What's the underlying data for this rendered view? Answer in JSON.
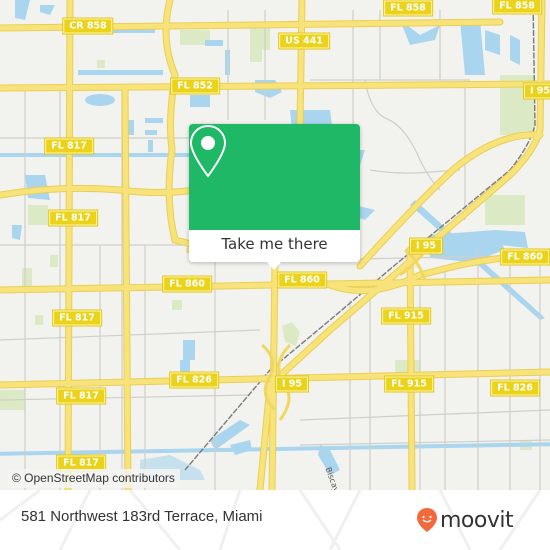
{
  "map": {
    "attribution": "© OpenStreetMap contributors",
    "colors": {
      "background": "#f2f2ee",
      "road": "#f7e37a",
      "road_casing": "#e8cf55",
      "minor_road": "#cfcfca",
      "water": "#a9d5ef",
      "park": "#dbeac5",
      "shield": "#ecd31b",
      "railway": "#888888"
    },
    "shields": [
      {
        "label": "CR 858"
      },
      {
        "label": "FL 858"
      },
      {
        "label": "FL 858"
      },
      {
        "label": "US 441"
      },
      {
        "label": "FL 852"
      },
      {
        "label": "FL 817"
      },
      {
        "label": "FL 817"
      },
      {
        "label": "FL 817"
      },
      {
        "label": "FL 817"
      },
      {
        "label": "FL 817"
      },
      {
        "label": "FL 860"
      },
      {
        "label": "FL 860"
      },
      {
        "label": "FL 860"
      },
      {
        "label": "I 95"
      },
      {
        "label": "I 95"
      },
      {
        "label": "FL 915"
      },
      {
        "label": "FL 915"
      },
      {
        "label": "FL 826"
      },
      {
        "label": "FL 826"
      },
      {
        "label": "I 95"
      }
    ],
    "street_labels": [
      {
        "label": "Biscay"
      }
    ]
  },
  "popup": {
    "icon": "map-pin-icon",
    "button_label": "Take me there",
    "color": "#1eb866"
  },
  "footer": {
    "address": "581 Northwest 183rd Terrace, Miami",
    "logo_text": "moovit",
    "logo_color": "#f26a3b"
  }
}
